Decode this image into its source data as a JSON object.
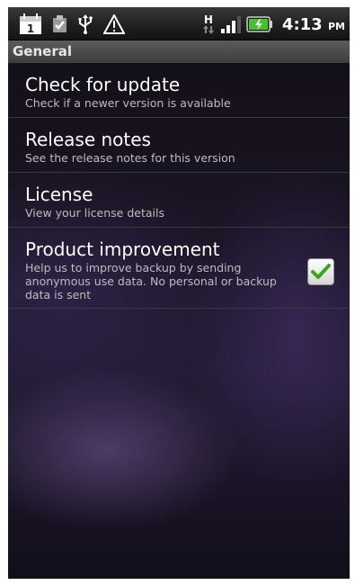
{
  "status_bar": {
    "time": "4:13",
    "ampm": "PM",
    "network_type": "H",
    "icons": [
      "calendar-icon",
      "clipboard-check-icon",
      "usb-icon",
      "warning-icon",
      "network-h-icon",
      "signal-icon",
      "battery-icon"
    ]
  },
  "section": {
    "title": "General"
  },
  "items": [
    {
      "title": "Check for update",
      "subtitle": "Check if a newer version is available"
    },
    {
      "title": "Release notes",
      "subtitle": "See the release notes for this version"
    },
    {
      "title": "License",
      "subtitle": "View your license details"
    },
    {
      "title": "Product improvement",
      "subtitle": "Help us to improve backup by sending anonymous use data. No personal or backup data is sent",
      "checked": true
    }
  ],
  "colors": {
    "checkmark": "#3ea51f",
    "battery": "#48c22a"
  }
}
